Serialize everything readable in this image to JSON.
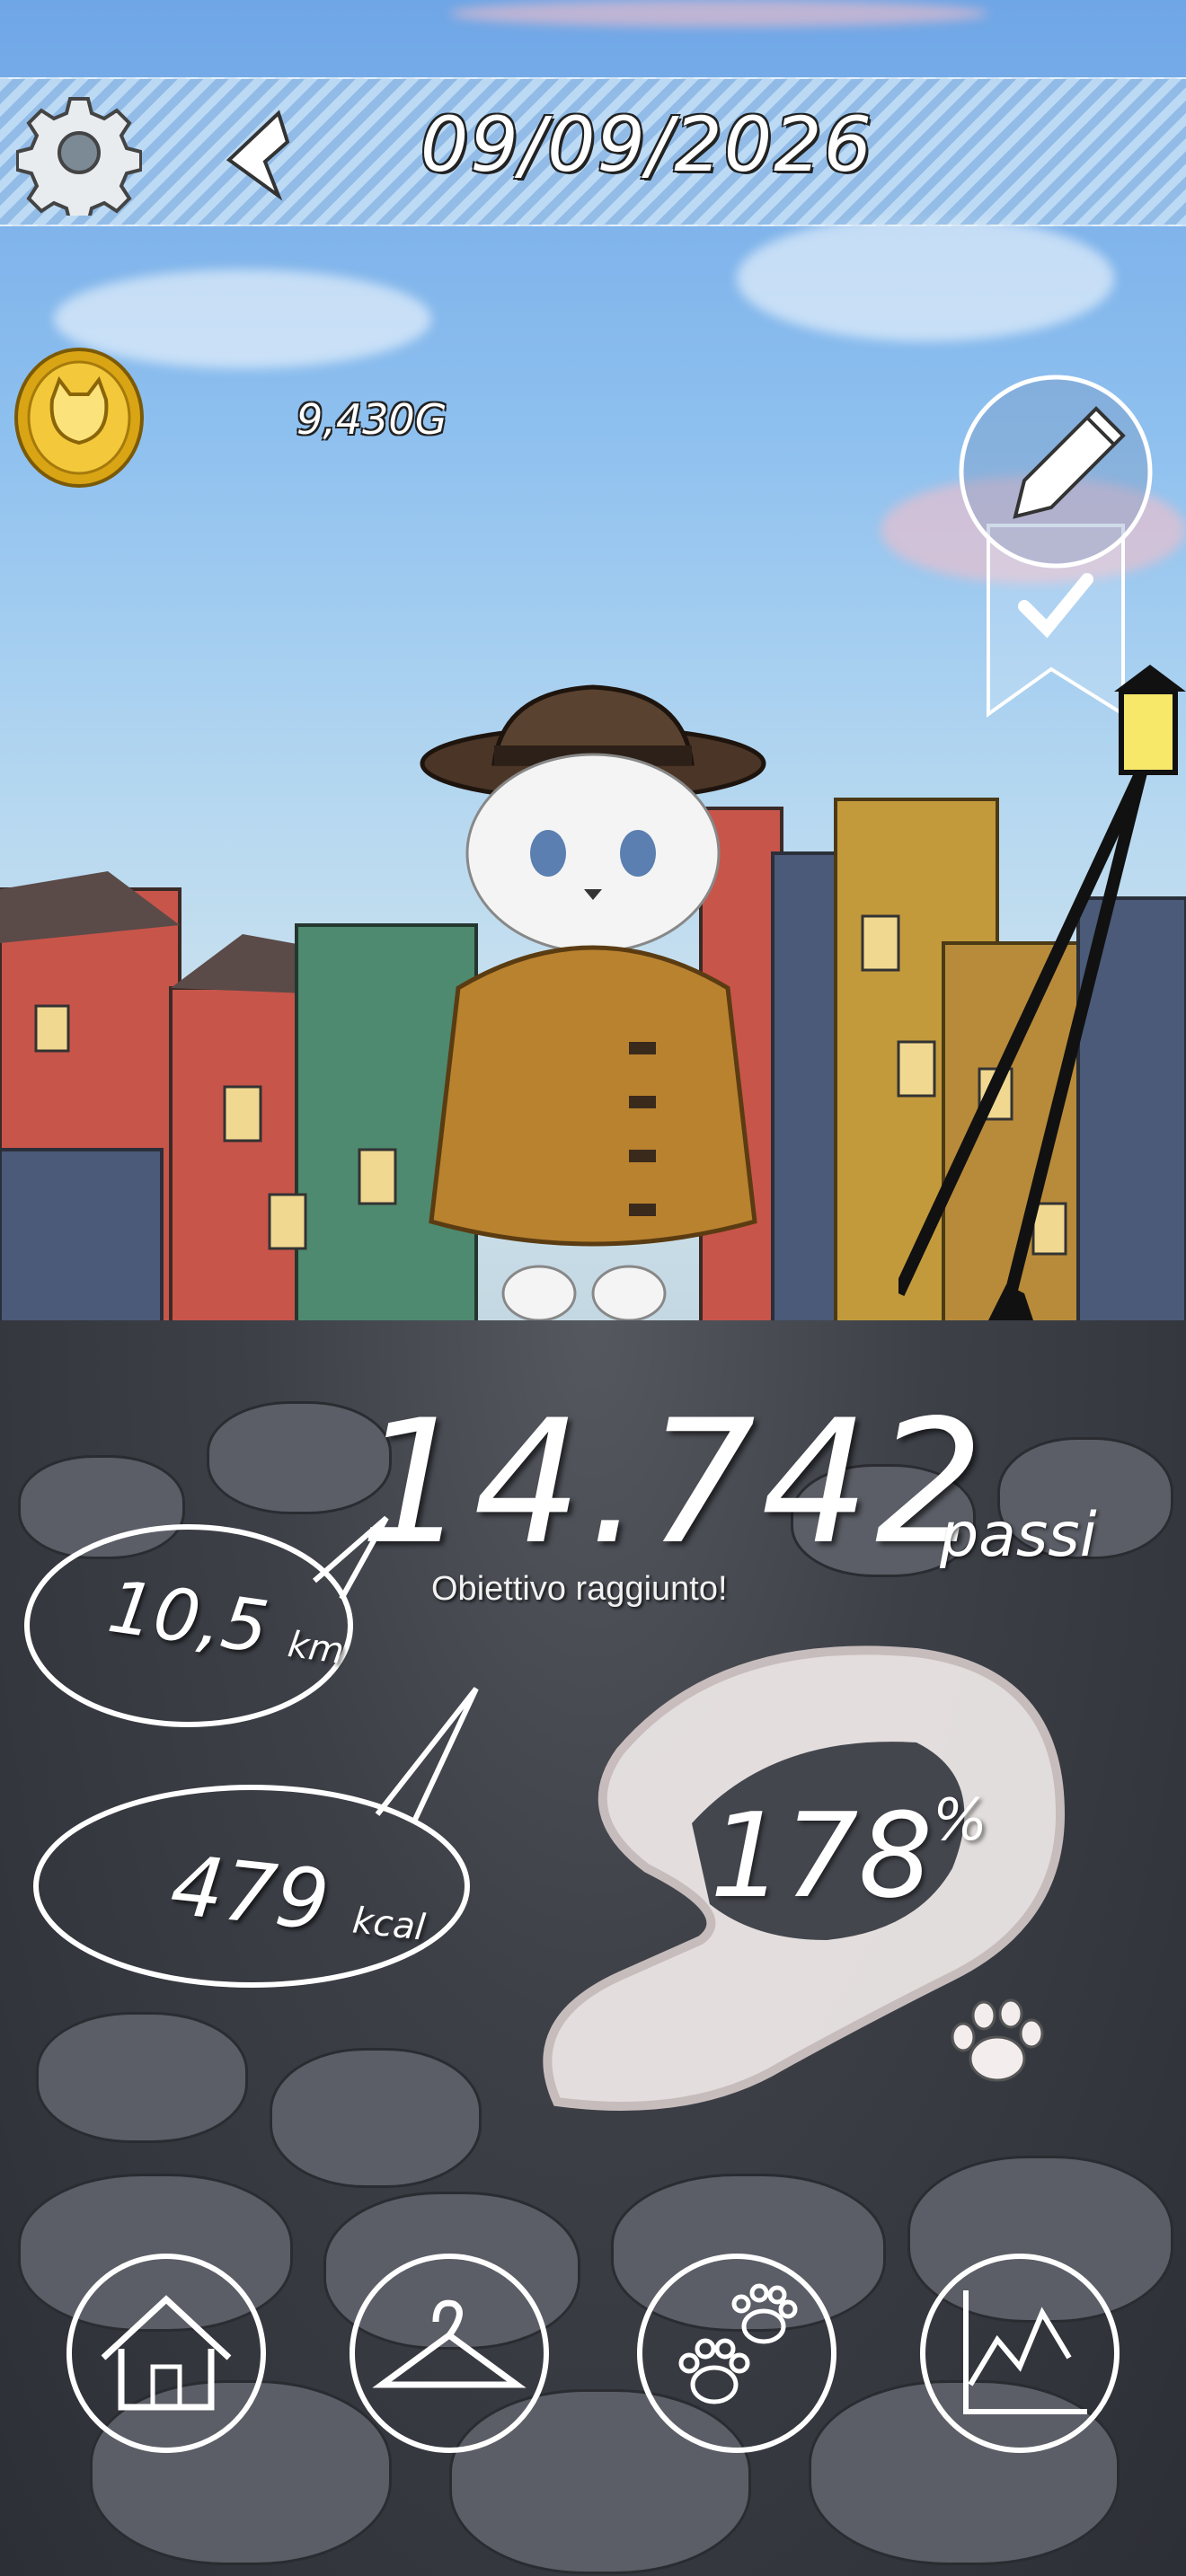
{
  "header": {
    "date": "09/09/2026",
    "settings_icon": "gear-icon",
    "back_icon": "back-arrow-icon"
  },
  "wallet": {
    "coins": "9,430G",
    "icon": "cat-coin-icon"
  },
  "edit_badge": {
    "icon": "pencil-icon",
    "check_icon": "checkmark-icon"
  },
  "stats": {
    "steps": "14.742",
    "steps_unit": "passi",
    "goal_status": "Obiettivo raggiunto!",
    "distance": "10,5",
    "distance_unit": "km",
    "calories": "479",
    "calories_unit": "kcal",
    "percent": "178",
    "percent_unit": "%",
    "progress_fraction": 1.78
  },
  "nav": [
    {
      "icon": "house-icon"
    },
    {
      "icon": "hanger-icon"
    },
    {
      "icon": "paw-prints-icon"
    },
    {
      "icon": "chart-icon"
    }
  ],
  "colors": {
    "sky": "#8ec0ef",
    "coin": "#e8b820",
    "coat": "#b9822f",
    "hat": "#4a3526",
    "text": "#ffffff"
  }
}
